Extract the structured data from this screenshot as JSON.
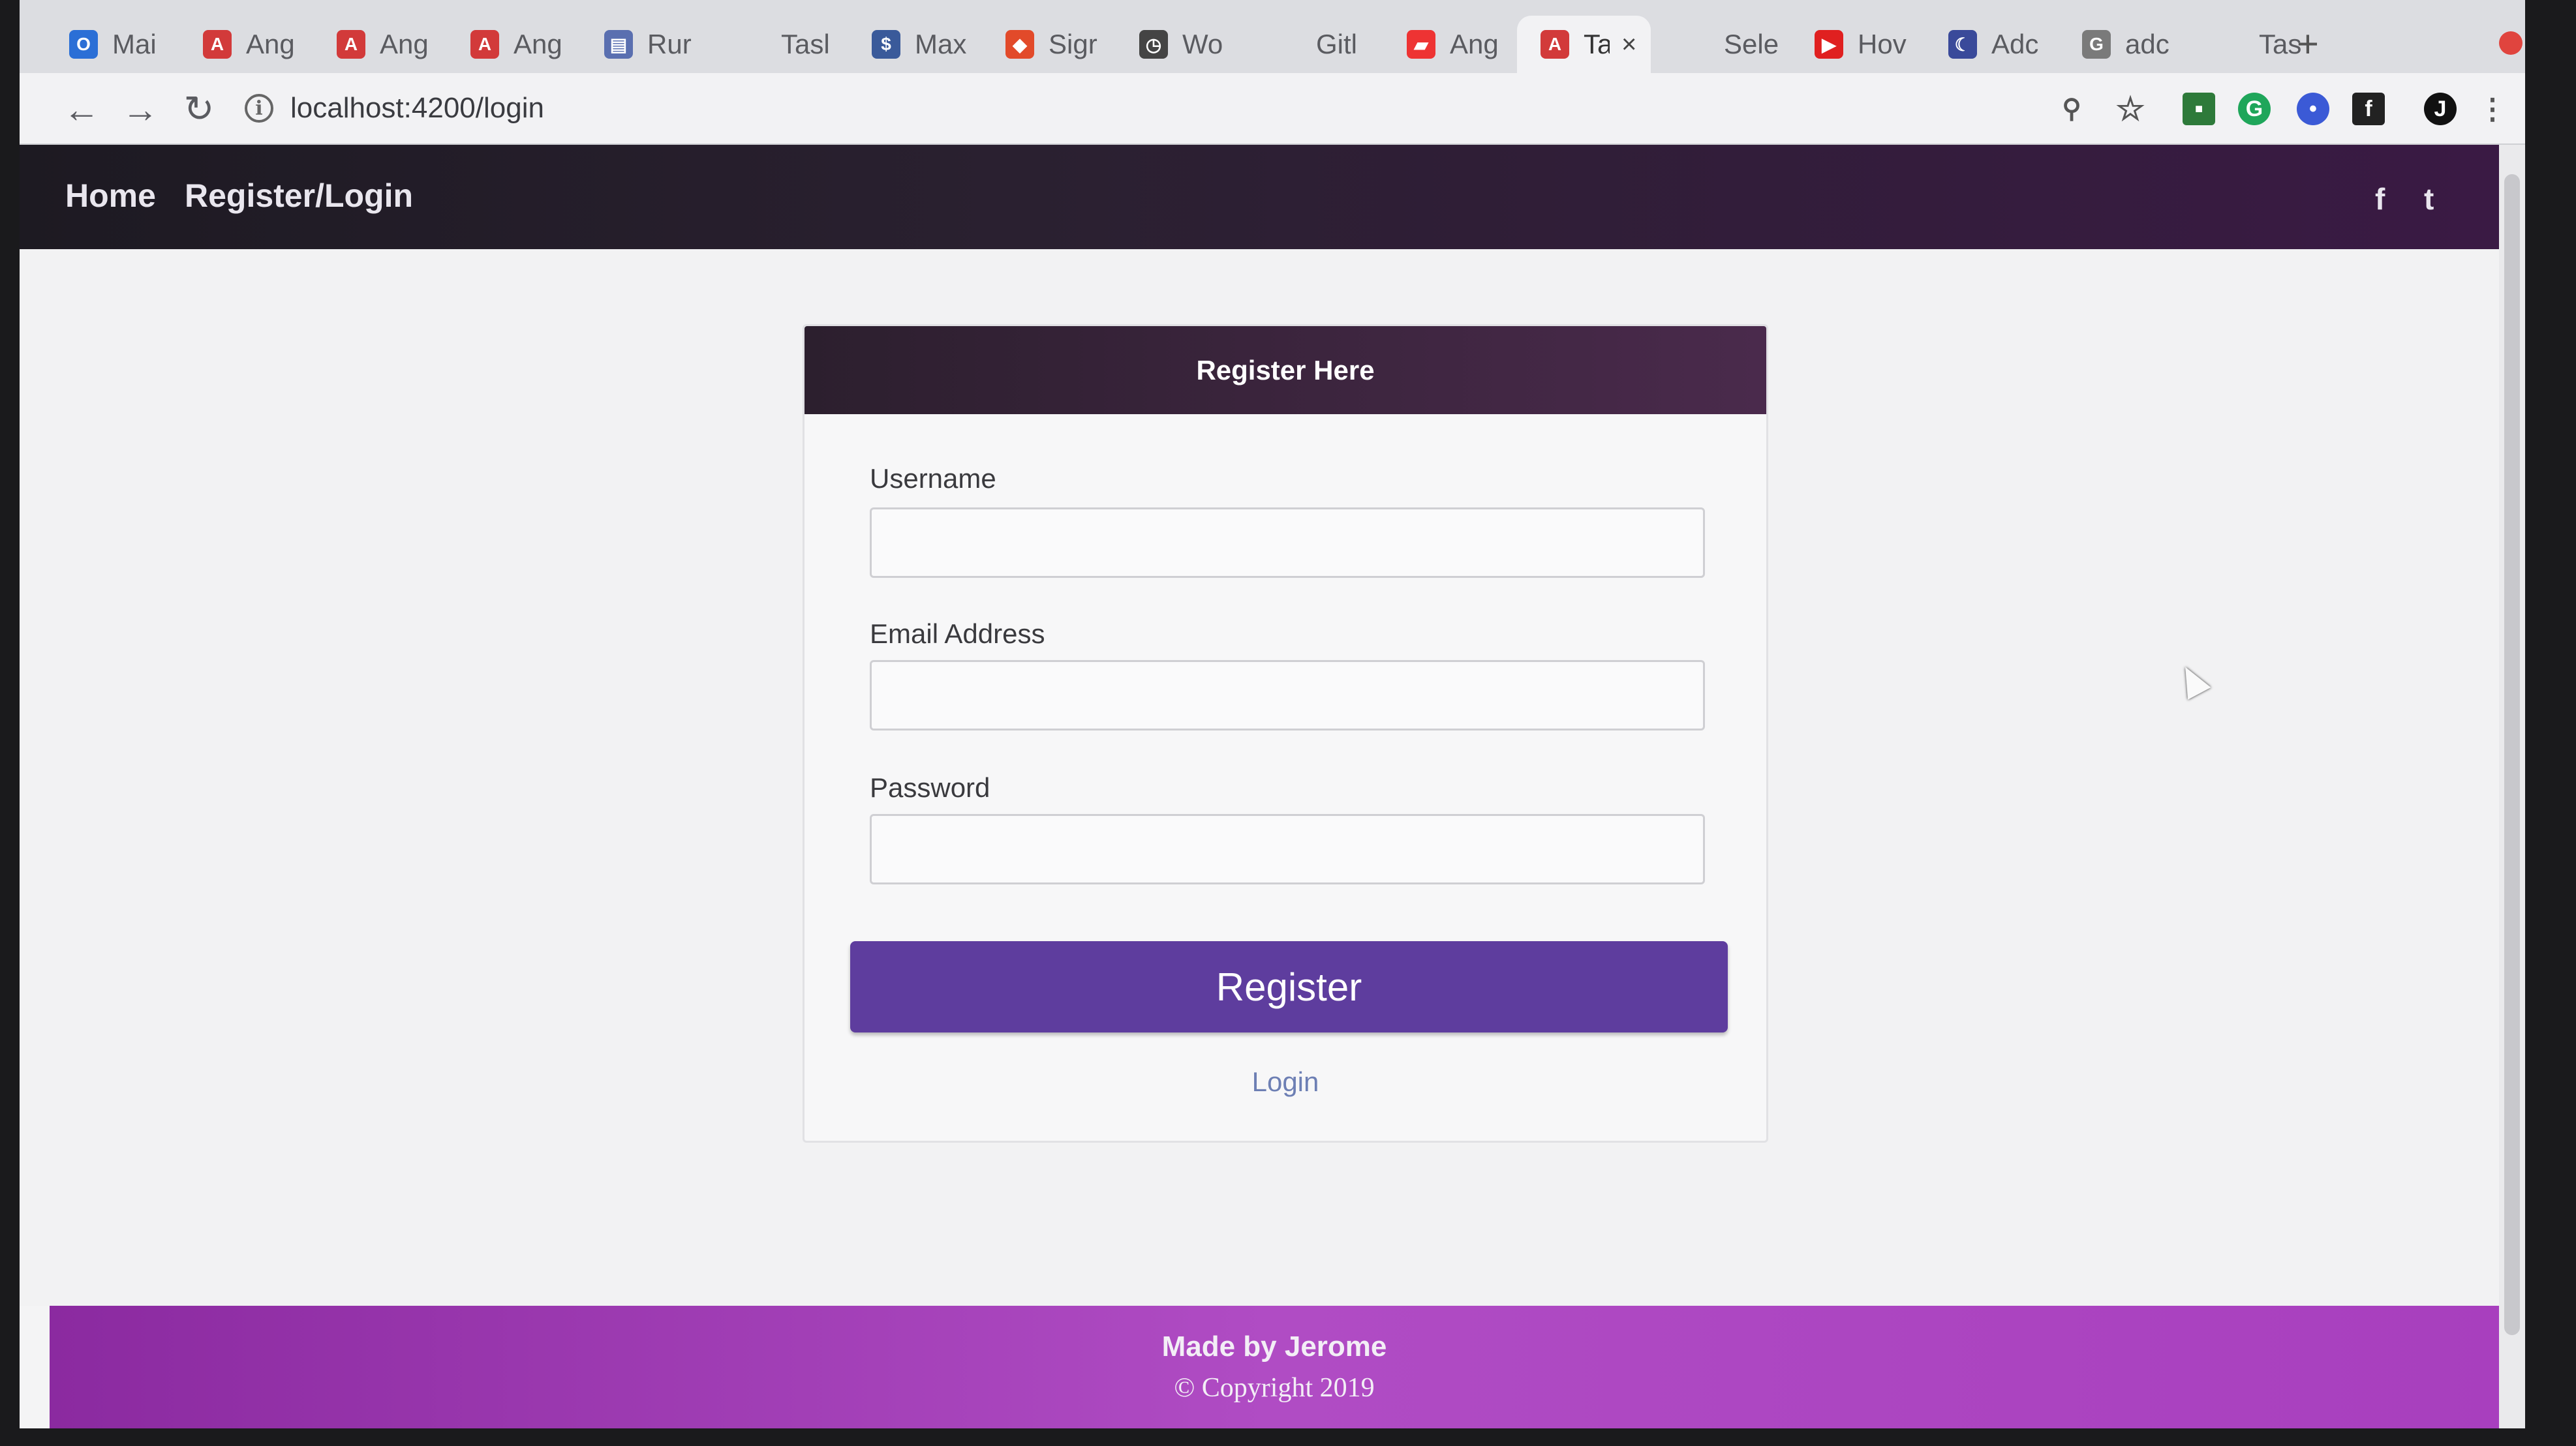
{
  "browser": {
    "tabs": [
      {
        "title": "Mai",
        "fav": "O",
        "color": "#2b6fd6"
      },
      {
        "title": "Ang",
        "fav": "A",
        "color": "#d23a3a"
      },
      {
        "title": "Ang",
        "fav": "A",
        "color": "#d23a3a"
      },
      {
        "title": "Ang",
        "fav": "A",
        "color": "#d23a3a"
      },
      {
        "title": "Rur",
        "fav": "▤",
        "color": "#5a6fb0"
      },
      {
        "title": "Tasl",
        "fav": "",
        "color": "transparent"
      },
      {
        "title": "Max",
        "fav": "$",
        "color": "#3a5a9a"
      },
      {
        "title": "Sigr",
        "fav": "◆",
        "color": "#e24a2a"
      },
      {
        "title": "Wo",
        "fav": "◷",
        "color": "#444"
      },
      {
        "title": "Gitl",
        "fav": "",
        "color": "transparent"
      },
      {
        "title": "Ang",
        "fav": "▰",
        "color": "#e33"
      },
      {
        "title": "Ta",
        "fav": "A",
        "color": "#d23a3a",
        "active": true
      },
      {
        "title": "Sele",
        "fav": "",
        "color": "transparent"
      },
      {
        "title": "Hov",
        "fav": "▶",
        "color": "#e02020"
      },
      {
        "title": "Adc",
        "fav": "☾",
        "color": "#3a4a9a"
      },
      {
        "title": "adc",
        "fav": "G",
        "color": "#7a7a7a"
      },
      {
        "title": "Tas",
        "fav": "",
        "color": "transparent"
      }
    ],
    "new_tab": "+",
    "url": "localhost:4200/login",
    "info_glyph": "i"
  },
  "nav": {
    "home": "Home",
    "register_login": "Register/Login",
    "facebook": "f",
    "twitter": "t"
  },
  "form": {
    "header": "Register Here",
    "username_label": "Username",
    "email_label": "Email Address",
    "password_label": "Password",
    "username_value": "",
    "email_value": "",
    "password_value": "",
    "register_label": "Register",
    "login_link": "Login"
  },
  "footer": {
    "made_by": "Made by Jerome",
    "copyright": "© Copyright 2019"
  }
}
